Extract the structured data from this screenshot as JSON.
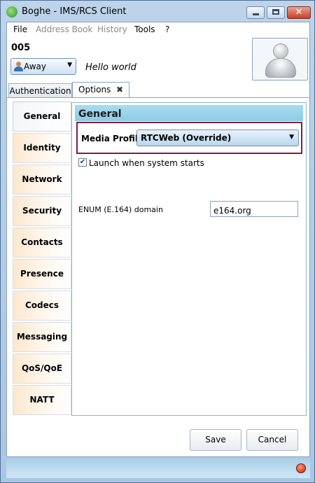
{
  "window": {
    "title": "Boghe - IMS/RCS Client",
    "min_label": "",
    "max_label": "",
    "close_label": "✕"
  },
  "menu": [
    "File",
    "Address Book",
    "History",
    "Tools",
    "?"
  ],
  "account": {
    "identity": "005",
    "status": "Away",
    "mood": "Hello world"
  },
  "tabs": {
    "authentication": "Authentication",
    "options": "Options",
    "close_glyph": "✖"
  },
  "sidebar": {
    "items": [
      {
        "label": "General"
      },
      {
        "label": "Identity"
      },
      {
        "label": "Network"
      },
      {
        "label": "Security"
      },
      {
        "label": "Contacts"
      },
      {
        "label": "Presence"
      },
      {
        "label": "Codecs"
      },
      {
        "label": "Messaging"
      },
      {
        "label": "QoS/QoE"
      },
      {
        "label": "NATT"
      }
    ]
  },
  "general": {
    "title": "General",
    "media_profile_label": "Media Profil",
    "media_profile_value": "RTCWeb (Override)",
    "launch_label": "Launch when system starts",
    "launch_checked": true,
    "enum_label": "ENUM (E.164) domain",
    "enum_value": "e164.org"
  },
  "actions": {
    "save": "Save",
    "cancel": "Cancel"
  },
  "colors": {
    "accent": "#8ccbe6",
    "profile_border": "#7a2040",
    "status_light": "#c01c0c"
  }
}
